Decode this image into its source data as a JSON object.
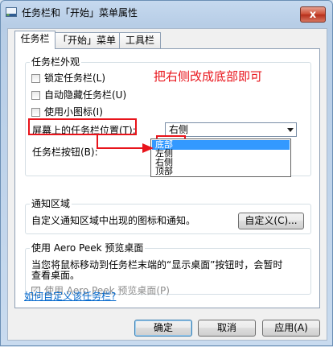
{
  "window": {
    "title": "任务栏和「开始」菜单属性",
    "close_glyph": "x"
  },
  "tabs": [
    {
      "label": "任务栏"
    },
    {
      "label": "「开始」菜单"
    },
    {
      "label": "工具栏"
    }
  ],
  "appearance": {
    "group_title": "任务栏外观",
    "lock_label": "锁定任务栏(L)",
    "autohide_label": "自动隐藏任务栏(U)",
    "small_icons_label": "使用小图标(I)",
    "position_label": "屏幕上的任务栏位置(T):",
    "position_value": "右侧",
    "position_options": [
      "底部",
      "左侧",
      "右侧",
      "顶部"
    ],
    "buttons_label": "任务栏按钮(B):"
  },
  "annotation": {
    "text": "把右侧改成底部即可",
    "color": "#e8141b"
  },
  "notification": {
    "group_title": "通知区域",
    "description": "自定义通知区域中出现的图标和通知。",
    "customize_button": "自定义(C)..."
  },
  "aero_peek": {
    "group_title": "使用 Aero Peek 预览桌面",
    "description_line1": "当您将鼠标移动到任务栏末端的“显示桌面”按钮时，会暂时",
    "description_line2": "查看桌面。",
    "checkbox_label": "使用 Aero Peek 预览桌面(P)"
  },
  "help_link": "如何自定义该任务栏?",
  "footer": {
    "ok": "确定",
    "cancel": "取消",
    "apply": "应用(A)"
  }
}
